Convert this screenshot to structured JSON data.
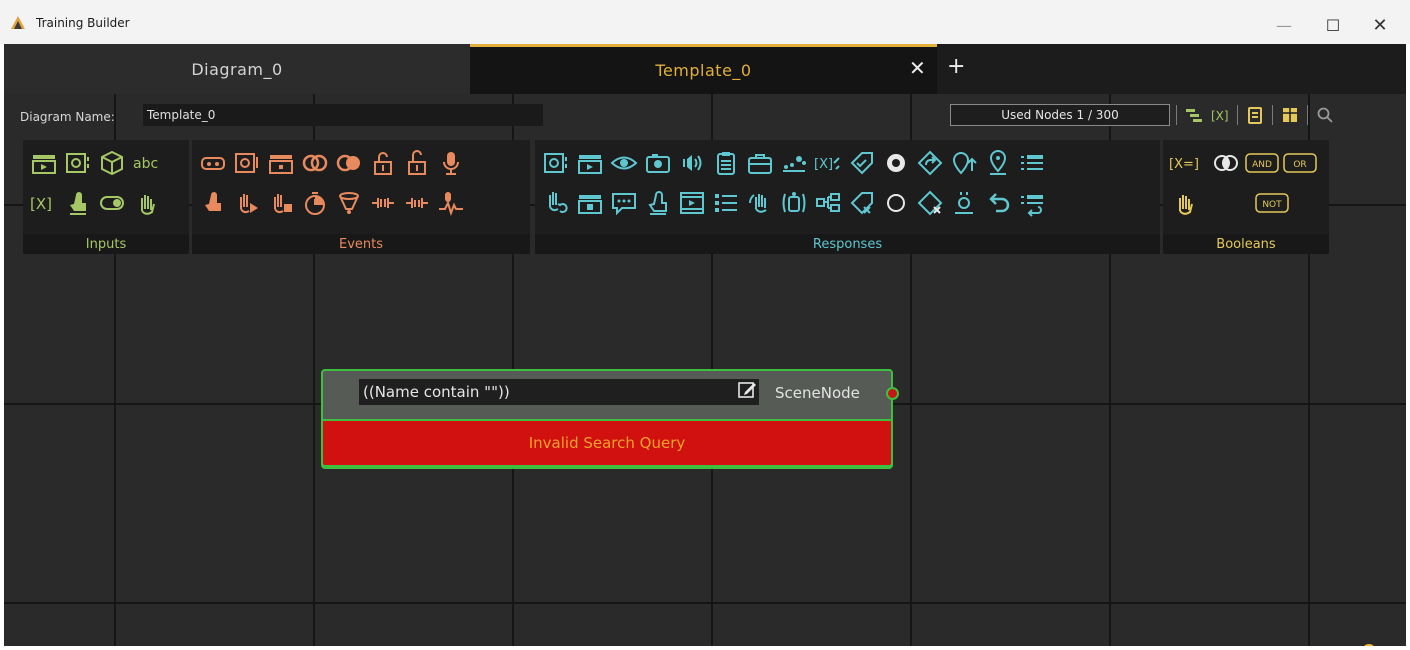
{
  "window": {
    "title": "Training Builder",
    "controls": {
      "minimize": "—",
      "maximize": "☐",
      "close": "✕"
    }
  },
  "tabs": [
    {
      "label": "Diagram_0",
      "active": false
    },
    {
      "label": "Template_0",
      "active": true
    }
  ],
  "tab_close": "✕",
  "tab_add": "+",
  "header": {
    "diagram_name_label": "Diagram Name:",
    "diagram_name_value": "Template_0",
    "used_nodes": "Used Nodes 1 / 300"
  },
  "palette": {
    "groups": [
      {
        "label": "Inputs",
        "color": "#a5c765"
      },
      {
        "label": "Events",
        "color": "#e88a5e"
      },
      {
        "label": "Responses",
        "color": "#5fc7cf"
      },
      {
        "label": "Booleans",
        "color": "#e4c95a"
      }
    ],
    "boolean_text": {
      "var_eq": "[X=]",
      "and": "AND",
      "or": "OR",
      "not": "NOT"
    },
    "input_text": {
      "abc": "abc",
      "var": "[X]"
    }
  },
  "node": {
    "query": "((Name contain \"\"))",
    "output_label": "SceneNode",
    "error": "Invalid Search Query"
  },
  "help": "?",
  "colors": {
    "accent": "#e2b03a",
    "node_border": "#3fbf3f",
    "error_bg": "#d11010",
    "error_text": "#f2a32a"
  }
}
